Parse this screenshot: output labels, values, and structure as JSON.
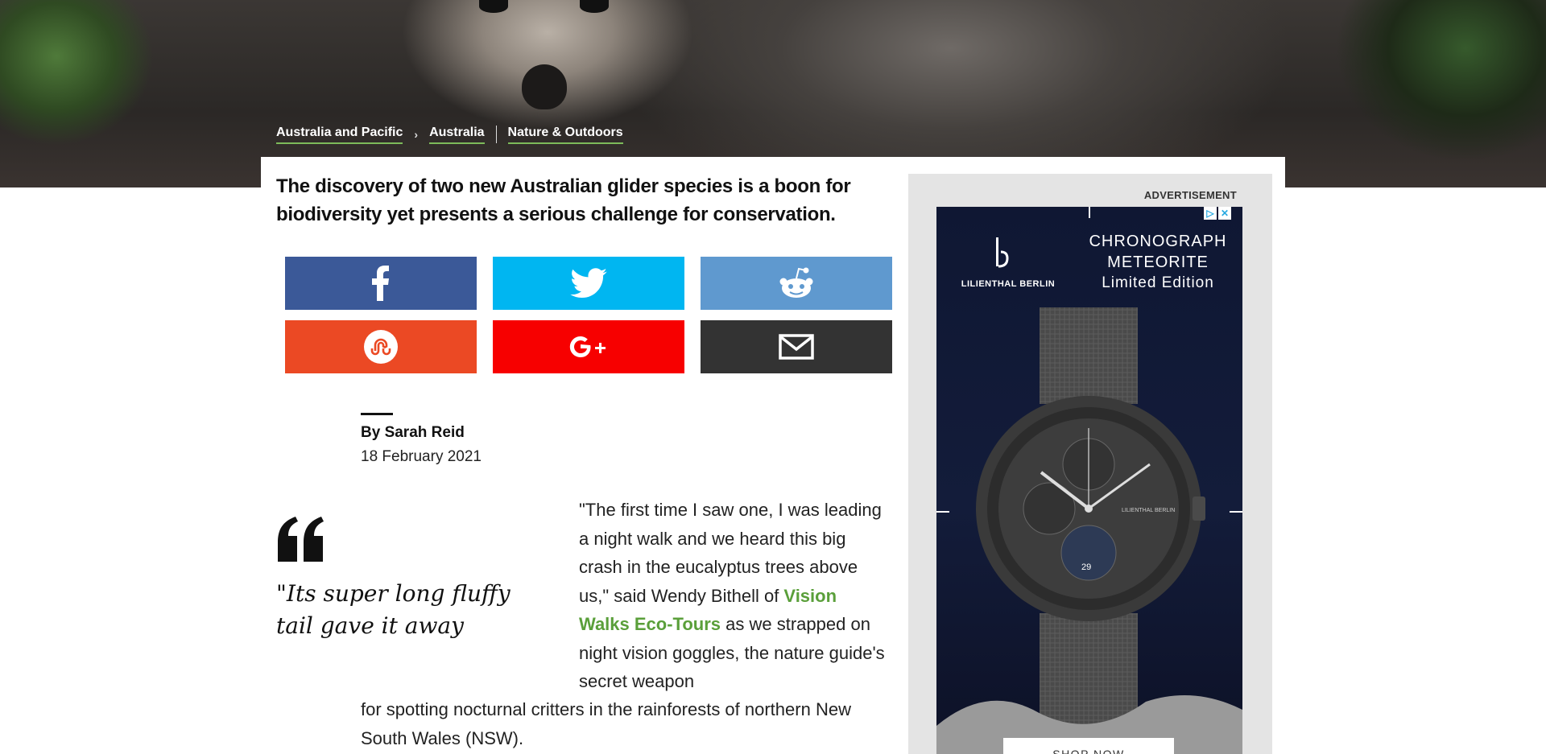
{
  "breadcrumb": {
    "items": [
      "Australia and Pacific",
      "Australia",
      "Nature & Outdoors"
    ]
  },
  "article": {
    "intro": "The discovery of two new Australian glider species is a boon for biodiversity yet presents a serious challenge for conservation.",
    "author": "By Sarah Reid",
    "date": "18 February 2021",
    "pull_quote": "\"Its super long fluffy tail gave it away",
    "body_part1": "\"The first time I saw one, I was leading a night walk and we heard this big crash in the eucalyptus trees above us,\" said Wendy Bithell of ",
    "body_link": "Vision Walks Eco-Tours",
    "body_part2": " as we strapped on night vision goggles, the nature guide's secret weapon",
    "body_part3": "for spotting nocturnal critters in the rainforests of northern New South Wales (NSW)."
  },
  "share": {
    "buttons": [
      {
        "name": "facebook",
        "icon": "facebook-icon",
        "color": "#3b5998"
      },
      {
        "name": "twitter",
        "icon": "twitter-icon",
        "color": "#00b6f1"
      },
      {
        "name": "reddit",
        "icon": "reddit-icon",
        "color": "#5f99cf"
      },
      {
        "name": "stumbleupon",
        "icon": "stumbleupon-icon",
        "color": "#eb4924"
      },
      {
        "name": "google-plus",
        "icon": "google-plus-icon",
        "color": "#f70000"
      },
      {
        "name": "email",
        "icon": "email-icon",
        "color": "#333333"
      }
    ]
  },
  "ad": {
    "label": "ADVERTISEMENT",
    "brand": "LILIENTHAL BERLIN",
    "headline_line1": "CHRONOGRAPH",
    "headline_line2": "METEORITE",
    "headline_line3": "Limited Edition",
    "watch_brand": "LILIENTHAL BERLIN",
    "watch_date": "29",
    "cta": "SHOP NOW"
  },
  "colors": {
    "link_green": "#5a9f3a",
    "breadcrumb_underline": "#7dbb5a"
  }
}
